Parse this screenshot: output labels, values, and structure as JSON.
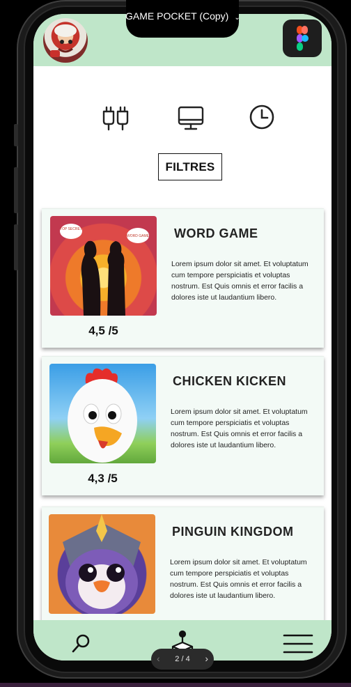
{
  "figma_bar": {
    "file_title": "GAME POCKET (Copy)",
    "chevron": "⌄"
  },
  "header": {
    "avatar_icon": "chef-avatar",
    "figma_icon": "figma-logo-icon"
  },
  "toolbar": {
    "icons": [
      "cables-icon",
      "monitor-icon",
      "clock-icon"
    ],
    "filter_label": "FILTRES"
  },
  "games": [
    {
      "title": "WORD GAME",
      "rating": "4,5 /5",
      "description": "Lorem ipsum dolor sit amet. Et voluptatum cum tempore perspiciatis et voluptas nostrum. Est Quis omnis et error facilis a dolores iste ut laudantium libero.",
      "bubble_left": "TOP SECRET",
      "bubble_right": "WORD GAME"
    },
    {
      "title": "CHICKEN KICKEN",
      "rating": "4,3 /5",
      "description": "Lorem ipsum dolor sit amet. Et voluptatum cum tempore perspiciatis et voluptas nostrum. Est Quis omnis et error facilis a dolores iste ut laudantium libero."
    },
    {
      "title": "PINGUIN KINGDOM",
      "description": "Lorem ipsum dolor sit amet. Et voluptatum cum tempore perspiciatis et voluptas nostrum. Est Quis omnis et error facilis a dolores iste ut laudantium libero."
    }
  ],
  "bottom_nav": {
    "icons": [
      "search-icon",
      "joystick-icon",
      "menu-icon"
    ]
  },
  "pager": {
    "prev": "‹",
    "count": "2 / 4",
    "next": "›"
  },
  "colors": {
    "mint": "#bfe6c9",
    "card_bg": "#f3faf6"
  }
}
